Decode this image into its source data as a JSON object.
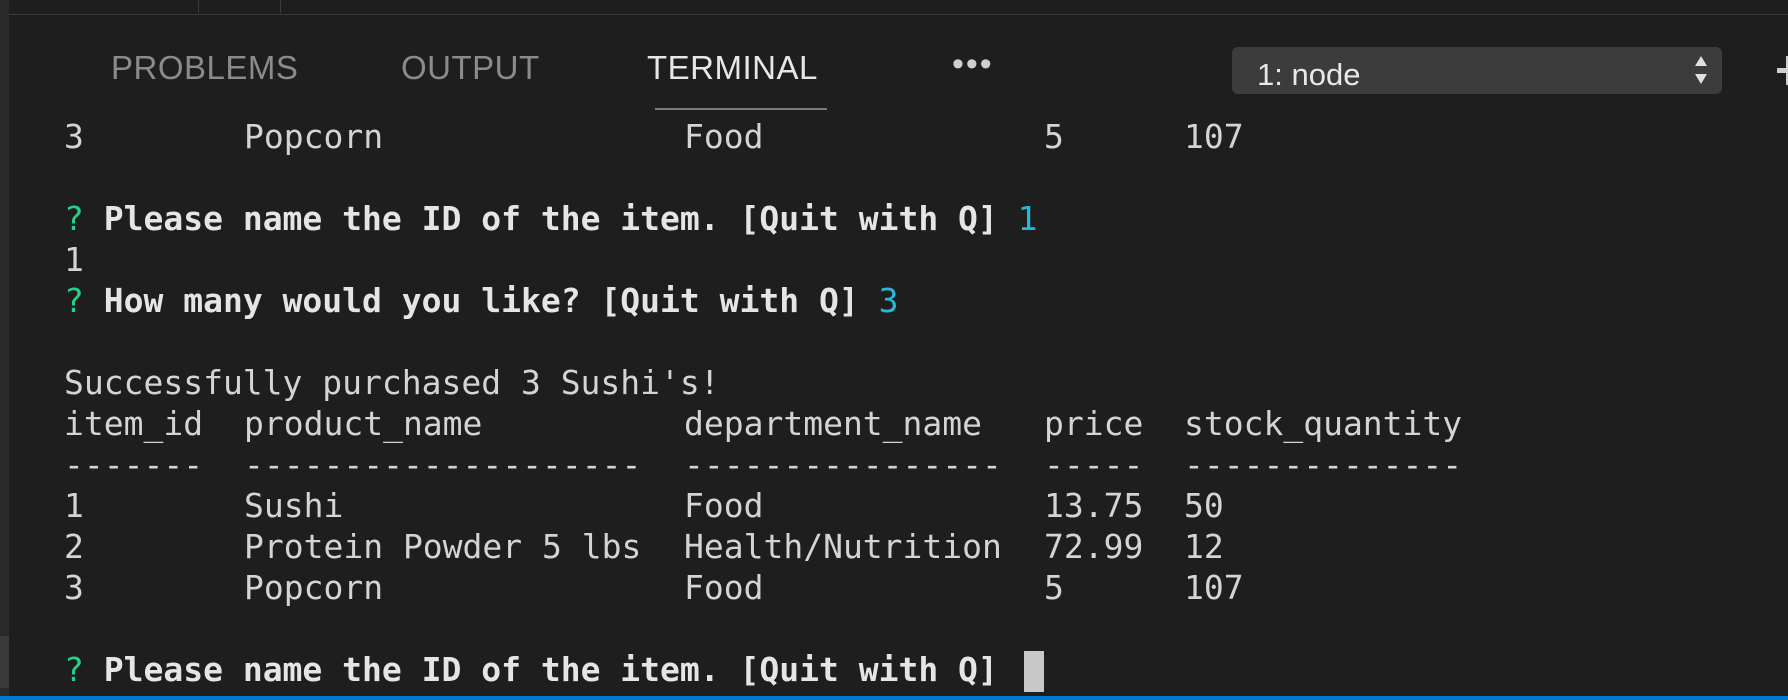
{
  "tabs": [
    {
      "label": "PROBLEMS",
      "active": false
    },
    {
      "label": "OUTPUT",
      "active": false
    },
    {
      "label": "TERMINAL",
      "active": true
    }
  ],
  "more_label": "•••",
  "terminal_select": {
    "value": "1: node"
  },
  "icons": [
    "more-actions-icon",
    "select-arrows-icon",
    "new-terminal-plus-icon",
    "cursor-block"
  ],
  "colors": {
    "background": "#1e1e1e",
    "prompt_question": "#23d18b",
    "answer": "#29b8db",
    "status_bar": "#007acc"
  },
  "terminal": {
    "row_top": {
      "id": "3",
      "name": "Popcorn",
      "dept": "Food",
      "price": "5",
      "qty": "107"
    },
    "prompt1": {
      "mark": "?",
      "text": "Please name the ID of the item. [Quit with Q]",
      "answer": "1"
    },
    "echo1": "1",
    "prompt2": {
      "mark": "?",
      "text": "How many would you like? [Quit with Q]",
      "answer": "3"
    },
    "success": "Successfully purchased 3 Sushi's!",
    "headers": {
      "id": "item_id",
      "name": "product_name",
      "dept": "department_name",
      "price": "price",
      "qty": "stock_quantity"
    },
    "dividers": {
      "id": "-------",
      "name": "--------------------",
      "dept": "----------------",
      "price": "-----",
      "qty": "--------------"
    },
    "rows": [
      {
        "id": "1",
        "name": "Sushi",
        "dept": "Food",
        "price": "13.75",
        "qty": "50"
      },
      {
        "id": "2",
        "name": "Protein Powder 5 lbs",
        "dept": "Health/Nutrition",
        "price": "72.99",
        "qty": "12"
      },
      {
        "id": "3",
        "name": "Popcorn",
        "dept": "Food",
        "price": "5",
        "qty": "107"
      }
    ],
    "prompt3": {
      "mark": "?",
      "text": "Please name the ID of the item. [Quit with Q]"
    }
  }
}
